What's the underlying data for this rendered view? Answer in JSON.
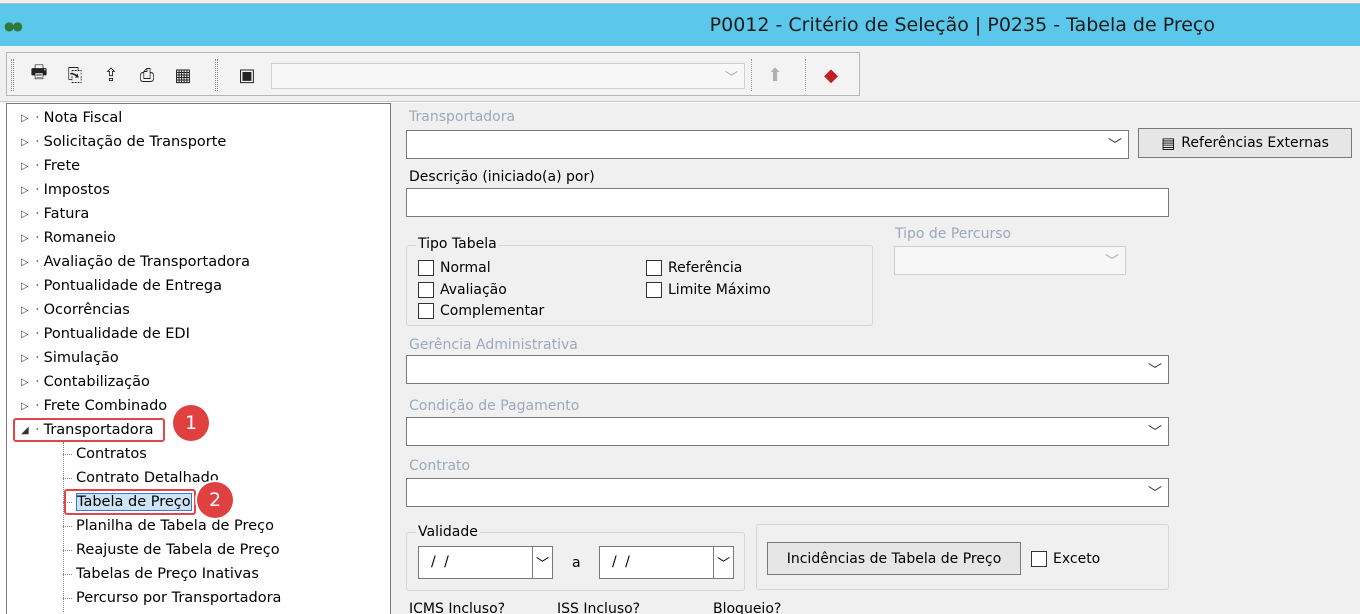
{
  "window": {
    "title": "P0012 - Critério de Seleção | P0235 - Tabela de Preço"
  },
  "toolbar": {
    "icons": [
      "printer-icon",
      "copy-pages-icon",
      "export-icon",
      "print-preview-icon",
      "report-icon",
      "save-icon",
      "delete-icon",
      "eraser-icon"
    ],
    "combo_value": ""
  },
  "tree": {
    "items": [
      {
        "label": "Nota Fiscal",
        "expanded": false
      },
      {
        "label": "Solicitação de Transporte",
        "expanded": false
      },
      {
        "label": "Frete",
        "expanded": false
      },
      {
        "label": "Impostos",
        "expanded": false
      },
      {
        "label": "Fatura",
        "expanded": false
      },
      {
        "label": "Romaneio",
        "expanded": false
      },
      {
        "label": "Avaliação de Transportadora",
        "expanded": false
      },
      {
        "label": "Pontualidade de Entrega",
        "expanded": false
      },
      {
        "label": "Ocorrências",
        "expanded": false
      },
      {
        "label": "Pontualidade de EDI",
        "expanded": false
      },
      {
        "label": "Simulação",
        "expanded": false
      },
      {
        "label": "Contabilização",
        "expanded": false
      },
      {
        "label": "Frete Combinado",
        "expanded": false
      },
      {
        "label": "Transportadora",
        "expanded": true
      }
    ],
    "children": [
      {
        "label": "Contratos"
      },
      {
        "label": "Contrato Detalhado"
      },
      {
        "label": "Tabela de Preço",
        "selected": true
      },
      {
        "label": "Planilha de Tabela de Preço"
      },
      {
        "label": "Reajuste de Tabela de Preço"
      },
      {
        "label": "Tabelas de Preço Inativas"
      },
      {
        "label": "Percurso por Transportadora"
      }
    ],
    "badges": [
      "1",
      "2"
    ]
  },
  "form": {
    "transportadora_label": "Transportadora",
    "transportadora_value": "",
    "ref_externas_button": "Referências Externas",
    "descricao_label": "Descrição (iniciado(a) por)",
    "descricao_value": "",
    "tipo_tabela": {
      "title": "Tipo Tabela",
      "options": [
        "Normal",
        "Avaliação",
        "Complementar",
        "Referência",
        "Limite Máximo"
      ]
    },
    "tipo_percurso_label": "Tipo de Percurso",
    "gerencia_label": "Gerência Administrativa",
    "condicao_label": "Condição de Pagamento",
    "contrato_label": "Contrato",
    "validade": {
      "title": "Validade",
      "from": "/ /",
      "to": "/ /",
      "separator": "a"
    },
    "incidencias_button": "Incidências de Tabela de Preço",
    "exceto_label": "Exceto",
    "bottom_labels": [
      "ICMS Incluso?",
      "ISS Incluso?",
      "Bloqueio?"
    ]
  },
  "colors": {
    "titlebar": "#5bc8eb",
    "highlight": "#e04747",
    "selection": "#cde4f7"
  }
}
